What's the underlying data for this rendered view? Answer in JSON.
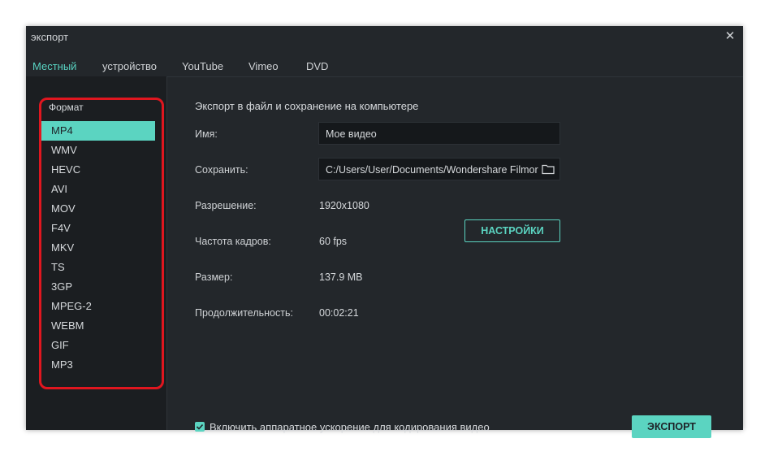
{
  "window": {
    "title": "экспорт",
    "close_glyph": "✕"
  },
  "tabs": [
    {
      "label": "Местный",
      "active": true
    },
    {
      "label": "устройство",
      "active": false
    },
    {
      "label": "YouTube",
      "active": false
    },
    {
      "label": "Vimeo",
      "active": false
    },
    {
      "label": "DVD",
      "active": false
    }
  ],
  "sidebar": {
    "title": "Формат",
    "formats": [
      "MP4",
      "WMV",
      "HEVC",
      "AVI",
      "MOV",
      "F4V",
      "MKV",
      "TS",
      "3GP",
      "MPEG-2",
      "WEBM",
      "GIF",
      "MP3"
    ],
    "selected": "MP4"
  },
  "main": {
    "heading": "Экспорт в файл и сохранение на компьютере",
    "name": {
      "label": "Имя:",
      "value": "Мое видео"
    },
    "save": {
      "label": "Сохранить:",
      "value": "C:/Users/User/Documents/Wondershare Filmora",
      "icon": "folder-icon"
    },
    "resolution": {
      "label": "Разрешение:",
      "value": "1920x1080"
    },
    "settings_button": "НАСТРОЙКИ",
    "framerate": {
      "label": "Частота кадров:",
      "value": "60 fps"
    },
    "size": {
      "label": "Размер:",
      "value": "137.9 MB"
    },
    "duration": {
      "label": "Продолжительность:",
      "value": "00:02:21"
    },
    "hw_accel": {
      "label": "Включить аппаратное ускорение для кодирования видео",
      "checked": true
    },
    "export_button": "ЭКСПОРТ"
  },
  "colors": {
    "accent": "#5bd4c1",
    "background": "#23272b",
    "sidebar": "#1b1e21",
    "highlight": "#e0161f"
  }
}
